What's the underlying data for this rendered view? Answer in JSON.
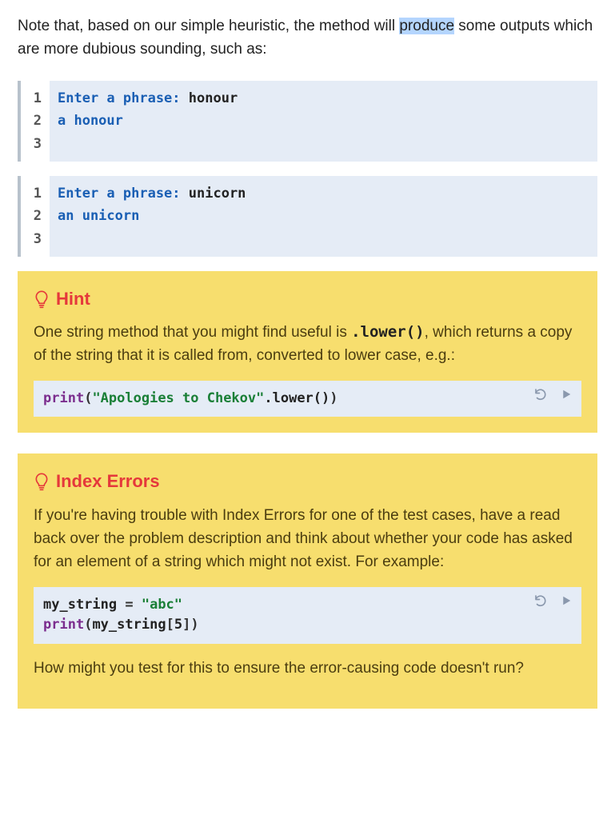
{
  "intro": {
    "before_highlight": "Note that, based on our simple heuristic, the method will ",
    "highlighted": "produce",
    "after_highlight": " some outputs which are more dubious sounding, such as:"
  },
  "example1": {
    "prompt_label": "Enter a phrase: ",
    "input": "honour",
    "output": "a honour"
  },
  "example2": {
    "prompt_label": "Enter a phrase: ",
    "input": "unicorn",
    "output": "an unicorn"
  },
  "hint1": {
    "title": "Hint",
    "text_before_code": "One string method that you might find useful is ",
    "inline_code": ".lower()",
    "text_after_code": ", which returns a copy of the string that it is called from, converted to lower case, e.g.:",
    "code": {
      "fn": "print",
      "string": "\"Apologies to Chekov\"",
      "method": ".lower()"
    }
  },
  "hint2": {
    "title": "Index Errors",
    "text": "If you're having trouble with Index Errors for one of the test cases, have a read back over the problem description and think about whether your code has asked for an element of a string which might not exist. For example:",
    "code": {
      "line1_var": "my_string",
      "line1_eq": " = ",
      "line1_str": "\"abc\"",
      "line2_fn": "print",
      "line2_arg_var": "my_string",
      "line2_idx_open": "[",
      "line2_idx_num": "5",
      "line2_idx_close": "]"
    },
    "after_text": "How might you test for this to ensure the error-causing code doesn't run?"
  },
  "line_numbers": {
    "n1": "1",
    "n2": "2",
    "n3": "3"
  }
}
